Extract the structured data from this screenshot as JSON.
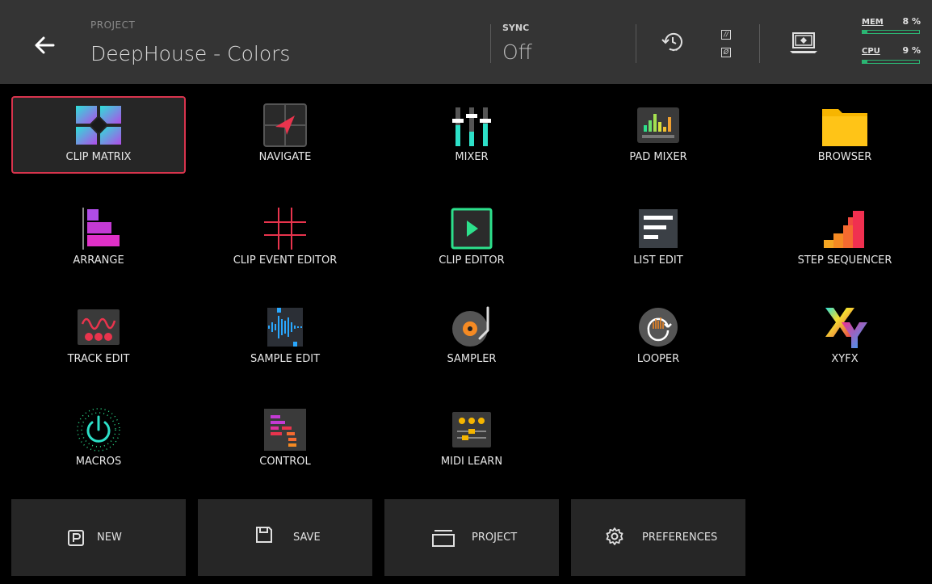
{
  "header": {
    "project_label": "PROJECT",
    "project_name": "DeepHouse - Colors",
    "sync_label": "SYNC",
    "sync_value": "Off",
    "box_top": "//",
    "box_bottom": "Ø",
    "mem_label": "MEM",
    "mem_value": "8 %",
    "mem_level": 0.08,
    "cpu_label": "CPU",
    "cpu_value": "9 %",
    "cpu_level": 0.09
  },
  "grid": [
    {
      "label": "CLIP MATRIX",
      "icon": "clip-matrix-icon",
      "selected": true
    },
    {
      "label": "NAVIGATE",
      "icon": "navigate-icon"
    },
    {
      "label": "MIXER",
      "icon": "mixer-icon"
    },
    {
      "label": "PAD MIXER",
      "icon": "pad-mixer-icon"
    },
    {
      "label": "BROWSER",
      "icon": "folder-icon"
    },
    {
      "label": "ARRANGE",
      "icon": "arrange-icon"
    },
    {
      "label": "CLIP EVENT EDITOR",
      "icon": "grid-icon"
    },
    {
      "label": "CLIP EDITOR",
      "icon": "play-icon"
    },
    {
      "label": "LIST EDIT",
      "icon": "list-icon"
    },
    {
      "label": "STEP SEQUENCER",
      "icon": "step-sequencer-icon"
    },
    {
      "label": "TRACK EDIT",
      "icon": "track-edit-icon"
    },
    {
      "label": "SAMPLE EDIT",
      "icon": "waveform-icon"
    },
    {
      "label": "SAMPLER",
      "icon": "turntable-icon"
    },
    {
      "label": "LOOPER",
      "icon": "looper-icon"
    },
    {
      "label": "XYFX",
      "icon": "xyfx-icon"
    },
    {
      "label": "MACROS",
      "icon": "power-icon"
    },
    {
      "label": "CONTROL",
      "icon": "control-icon"
    },
    {
      "label": "MIDI LEARN",
      "icon": "midi-learn-icon"
    }
  ],
  "bottom": [
    {
      "label": "NEW",
      "icon": "new-icon"
    },
    {
      "label": "SAVE",
      "icon": "save-icon"
    },
    {
      "label": "PROJECT",
      "icon": "project-folder-icon"
    },
    {
      "label": "PREFERENCES",
      "icon": "gear-icon"
    }
  ],
  "colors": {
    "accent_selected": "#d8344d",
    "meter": "#2bb673",
    "header_bg": "#343434",
    "tile_bg": "#262626"
  }
}
